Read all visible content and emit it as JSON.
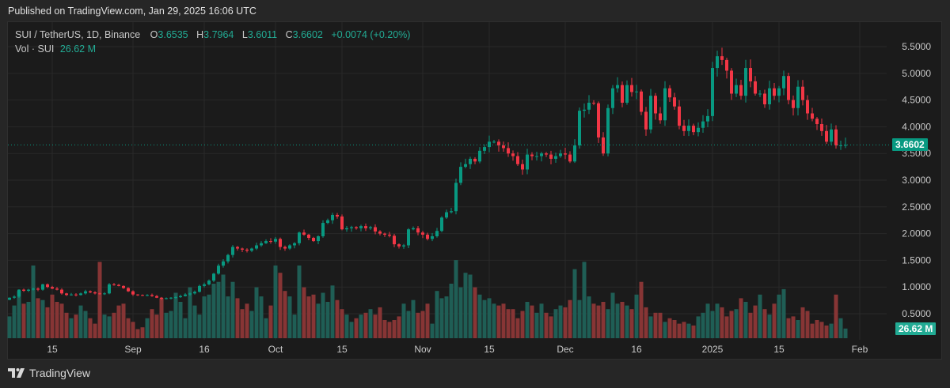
{
  "published": "Published on TradingView.com, Jan 29, 2025 16:06 UTC",
  "legend": {
    "symbol": "SUI / TetherUS, 1D, Binance",
    "o_label": "O",
    "o": "3.6535",
    "h_label": "H",
    "h": "3.7964",
    "l_label": "L",
    "l": "3.6011",
    "c_label": "C",
    "c": "3.6602",
    "change": "+0.0074 (+0.20%)",
    "vol_label": "Vol · SUI",
    "vol": "26.62 M"
  },
  "price_tag": "3.6602",
  "volume_tag": "26.62 M",
  "footer": {
    "brand": "TradingView"
  },
  "colors": {
    "up": "#089981",
    "down": "#f23645",
    "up_vol": "#1f5e55",
    "down_vol": "#873535",
    "tag": "#089981",
    "vol_tag": "#22ab94"
  },
  "chart_data": {
    "type": "candlestick",
    "title": "SUI / TetherUS, 1D, Binance",
    "start_date": "2024-08-06",
    "end_date": "2025-01-29",
    "ylim": [
      0.4,
      5.7
    ],
    "y_ticks": [
      "5.5000",
      "5.0000",
      "4.5000",
      "4.0000",
      "3.5000",
      "3.0000",
      "2.5000",
      "2.0000",
      "1.5000",
      "1.0000",
      "0.5000"
    ],
    "y_tick_values": [
      5.5,
      5.0,
      4.5,
      4.0,
      3.5,
      3.0,
      2.5,
      2.0,
      1.5,
      1.0,
      0.5
    ],
    "x_ticks": [
      {
        "label": "15",
        "day": 9
      },
      {
        "label": "Sep",
        "day": 26
      },
      {
        "label": "16",
        "day": 41
      },
      {
        "label": "Oct",
        "day": 56
      },
      {
        "label": "15",
        "day": 70
      },
      {
        "label": "Nov",
        "day": 87
      },
      {
        "label": "15",
        "day": 101
      },
      {
        "label": "Dec",
        "day": 117
      },
      {
        "label": "16",
        "day": 132
      },
      {
        "label": "2025",
        "day": 148
      },
      {
        "label": "15",
        "day": 162
      },
      {
        "label": "Feb",
        "day": 179
      }
    ],
    "first_open": 0.76,
    "close": [
      0.8,
      0.82,
      0.95,
      0.93,
      0.95,
      0.97,
      0.95,
      1.05,
      1.0,
      0.97,
      0.95,
      0.88,
      0.85,
      0.86,
      0.85,
      0.88,
      0.92,
      0.9,
      0.88,
      0.87,
      0.88,
      1.05,
      1.04,
      1.02,
      0.98,
      0.92,
      0.86,
      0.85,
      0.84,
      0.85,
      0.83,
      0.8,
      0.78,
      0.79,
      0.8,
      0.81,
      0.83,
      0.86,
      0.88,
      0.91,
      1.02,
      1.05,
      1.12,
      1.25,
      1.4,
      1.48,
      1.6,
      1.75,
      1.72,
      1.7,
      1.68,
      1.72,
      1.78,
      1.82,
      1.86,
      1.85,
      1.9,
      1.75,
      1.72,
      1.78,
      1.82,
      2.02,
      1.98,
      1.92,
      1.86,
      1.95,
      2.2,
      2.25,
      2.35,
      2.32,
      2.08,
      2.1,
      2.12,
      2.1,
      2.14,
      2.1,
      2.12,
      2.04,
      2.0,
      1.98,
      1.96,
      1.8,
      1.76,
      1.78,
      2.08,
      2.1,
      2.02,
      1.98,
      1.9,
      1.95,
      2.05,
      2.3,
      2.4,
      2.42,
      2.95,
      3.25,
      3.3,
      3.4,
      3.35,
      3.55,
      3.62,
      3.72,
      3.72,
      3.65,
      3.6,
      3.5,
      3.45,
      3.3,
      3.2,
      3.48,
      3.45,
      3.45,
      3.5,
      3.48,
      3.4,
      3.45,
      3.5,
      3.48,
      3.35,
      3.65,
      4.3,
      4.32,
      4.45,
      4.44,
      3.8,
      3.5,
      4.35,
      4.72,
      4.78,
      4.45,
      4.78,
      4.65,
      4.66,
      4.28,
      3.95,
      4.58,
      4.25,
      4.12,
      4.72,
      4.55,
      4.38,
      4.02,
      3.92,
      4.02,
      3.9,
      3.98,
      4.1,
      4.2,
      5.1,
      5.32,
      5.25,
      5.05,
      4.62,
      4.78,
      4.58,
      5.1,
      4.85,
      4.62,
      4.62,
      4.42,
      4.72,
      4.58,
      4.72,
      4.95,
      4.5,
      4.35,
      4.75,
      4.5,
      4.25,
      4.15,
      4.05,
      3.92,
      3.72,
      3.95,
      3.65,
      3.6535,
      3.6602
    ],
    "last_high": 3.7964,
    "last_low": 3.6011,
    "volume_millions": [
      60,
      90,
      130,
      95,
      100,
      200,
      110,
      105,
      85,
      120,
      100,
      95,
      70,
      55,
      65,
      90,
      75,
      55,
      40,
      210,
      65,
      60,
      70,
      90,
      95,
      55,
      45,
      25,
      30,
      55,
      80,
      65,
      110,
      70,
      75,
      125,
      100,
      55,
      140,
      90,
      65,
      115,
      120,
      150,
      155,
      175,
      115,
      155,
      110,
      80,
      95,
      75,
      140,
      115,
      55,
      90,
      200,
      180,
      130,
      115,
      65,
      200,
      140,
      115,
      120,
      95,
      125,
      100,
      145,
      105,
      80,
      65,
      45,
      55,
      65,
      70,
      80,
      65,
      85,
      50,
      45,
      50,
      60,
      95,
      75,
      105,
      70,
      75,
      95,
      40,
      130,
      110,
      115,
      150,
      215,
      140,
      180,
      175,
      140,
      120,
      105,
      110,
      95,
      90,
      95,
      80,
      80,
      55,
      75,
      100,
      90,
      70,
      95,
      70,
      60,
      80,
      90,
      85,
      105,
      190,
      105,
      210,
      115,
      95,
      90,
      100,
      80,
      125,
      95,
      100,
      90,
      80,
      120,
      155,
      85,
      60,
      70,
      70,
      45,
      55,
      50,
      40,
      45,
      40,
      35,
      60,
      70,
      95,
      75,
      95,
      85,
      60,
      75,
      80,
      110,
      100,
      70,
      90,
      120,
      80,
      65,
      95,
      120,
      135,
      55,
      60,
      50,
      85,
      75,
      40,
      50,
      45,
      35,
      40,
      120,
      55,
      26.62
    ]
  }
}
